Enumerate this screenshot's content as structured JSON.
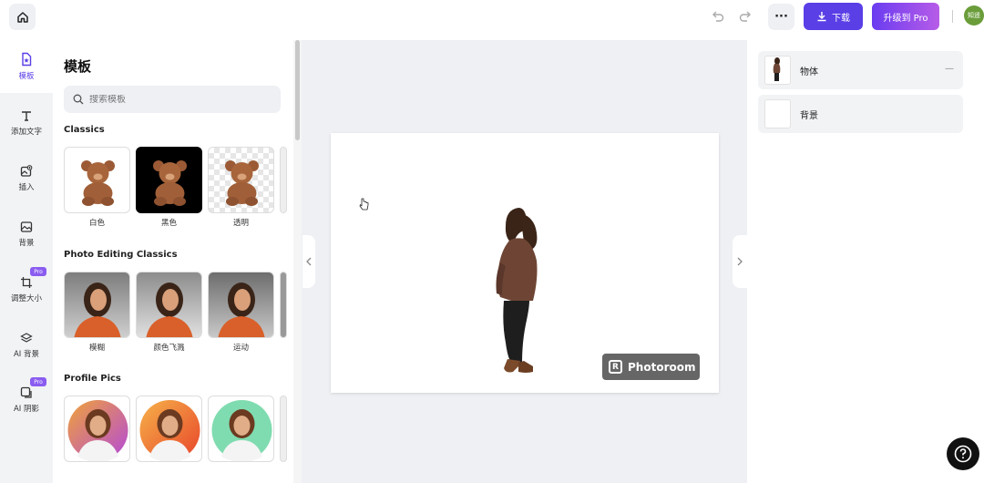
{
  "topbar": {
    "download_label": "下载",
    "upgrade_label": "升级到 Pro",
    "more_label": "···",
    "avatar_text": "知遥"
  },
  "rail": {
    "items": [
      {
        "label": "模板"
      },
      {
        "label": "添加文字"
      },
      {
        "label": "插入"
      },
      {
        "label": "背景"
      },
      {
        "label": "调整大小",
        "badge": "Pro"
      },
      {
        "label": "AI 背景"
      },
      {
        "label": "AI 阴影",
        "badge": "Pro"
      }
    ]
  },
  "panel": {
    "title": "模板",
    "search_placeholder": "搜索模板",
    "sections": [
      {
        "title": "Classics",
        "items": [
          {
            "label": "白色"
          },
          {
            "label": "黑色"
          },
          {
            "label": "透明"
          }
        ]
      },
      {
        "title": "Photo Editing Classics",
        "items": [
          {
            "label": "模糊"
          },
          {
            "label": "颜色飞溅"
          },
          {
            "label": "运动"
          }
        ]
      },
      {
        "title": "Profile Pics",
        "items": [
          {
            "label": ""
          },
          {
            "label": ""
          },
          {
            "label": ""
          }
        ]
      }
    ]
  },
  "canvas": {
    "watermark": "Photoroom"
  },
  "layers": {
    "items": [
      {
        "name": "物体"
      },
      {
        "name": "背景"
      }
    ]
  },
  "colors": {
    "accent": "#5a3ee6",
    "pro_gradient_start": "#6a3cf0",
    "pro_gradient_end": "#b75ce8"
  }
}
